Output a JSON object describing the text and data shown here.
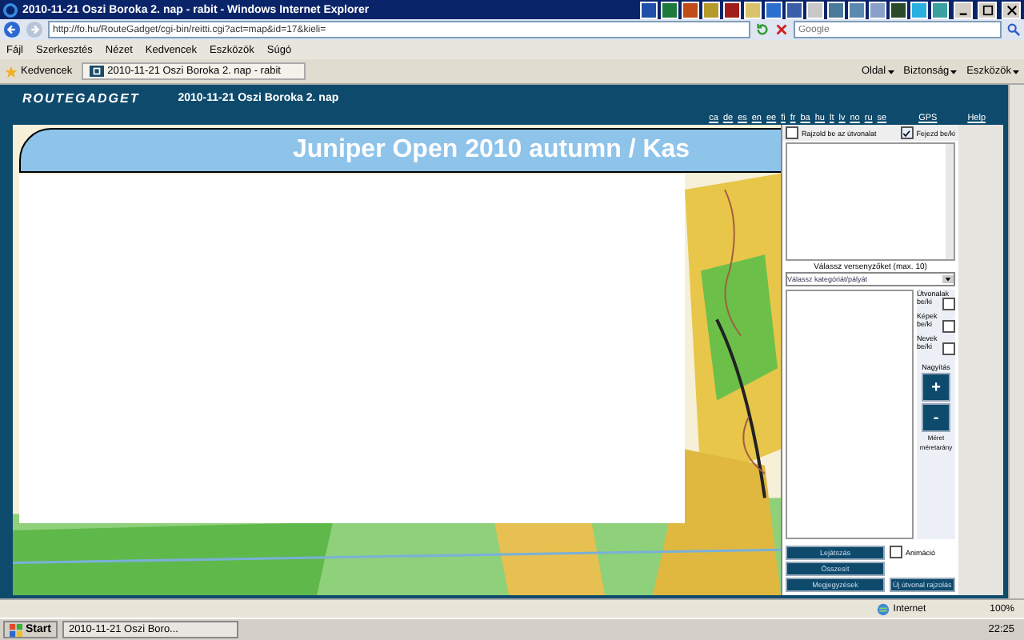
{
  "window": {
    "title": "2010-11-21 Oszi Boroka 2. nap - rabit - Windows Internet Explorer"
  },
  "address_bar": {
    "url": "http://fo.hu/RouteGadget/cgi-bin/reitti.cgi?act=map&id=17&kieli=",
    "search_placeholder": "Google"
  },
  "menu": [
    "Fájl",
    "Szerkesztés",
    "Nézet",
    "Kedvencek",
    "Eszközök",
    "Súgó"
  ],
  "favorites": {
    "label": "Kedvencek",
    "tab": "2010-11-21 Oszi Boroka 2. nap - rabit"
  },
  "command_bar": [
    "Oldal",
    "Biztonság",
    "Eszközök"
  ],
  "header": {
    "logo": "ROUTEGADGET",
    "event": "2010-11-21 Oszi Boroka 2. nap",
    "languages": [
      "ca",
      "de",
      "es",
      "en",
      "ee",
      "fi",
      "fr",
      "ba",
      "hu",
      "lt",
      "lv",
      "no",
      "ru",
      "se"
    ],
    "links": [
      "GPS",
      "Help"
    ]
  },
  "banner": {
    "title": "Juniper Open 2010 autumn / Kas"
  },
  "panel": {
    "checkboxes": [
      {
        "label": "Rajzold be az útvonalat",
        "checked": false
      },
      {
        "label": "Fejezd be/ki",
        "checked": true
      }
    ],
    "runner_label": "Válassz versenyzőket (max. 10)",
    "dropdown": "Válassz kategóriát/pályát",
    "toggles": [
      {
        "label": "Útvonalak",
        "sub": "be/ki",
        "checked": false
      },
      {
        "label": "Képek",
        "sub": "be/ki",
        "checked": false
      },
      {
        "label": "Nevek",
        "sub": "be/ki",
        "checked": false
      }
    ],
    "zoom_label": "Nagyítás",
    "zoom_in": "+",
    "zoom_out": "-",
    "scale_label": "Méret",
    "scale_value": "méretarány",
    "buttons": [
      "Lejátszás",
      "Összesít",
      "Megjegyzések"
    ],
    "animate": {
      "label": "Animáció",
      "checked": false
    },
    "extra_button": "Új útvonal rajzolás"
  },
  "status_bar": {
    "zone": "Internet",
    "zoom": "100%"
  },
  "taskbar": {
    "start": "Start",
    "task": "2010-11-21 Oszi Boro...",
    "clock": "22:25"
  }
}
